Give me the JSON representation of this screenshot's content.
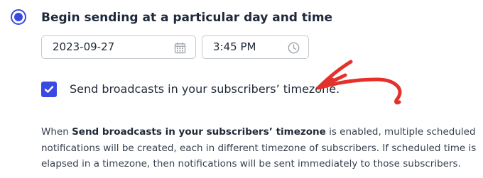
{
  "schedule_option": {
    "label": "Begin sending at a particular day and time",
    "selected": true
  },
  "date_field": {
    "value": "2023-09-27",
    "icon": "calendar-icon"
  },
  "time_field": {
    "value": "3:45 PM",
    "icon": "clock-icon"
  },
  "timezone_checkbox": {
    "label": "Send broadcasts in your subscribers’ timezone.",
    "checked": true
  },
  "annotation": {
    "icon": "red-arrow-icon",
    "color": "#e5312b"
  },
  "help_text": {
    "prefix": "When ",
    "emphasis": "Send broadcasts in your subscribers’ timezone",
    "suffix": " is enabled, multiple scheduled notifications will be created, each in different timezone of subscribers. If scheduled time is elapsed in a timezone, then notifications will be sent immediately to those subscribers."
  },
  "colors": {
    "accent": "#3b49e3",
    "border": "#c6cad1",
    "icon_gray": "#a0a6ae",
    "text": "#1f2937"
  }
}
